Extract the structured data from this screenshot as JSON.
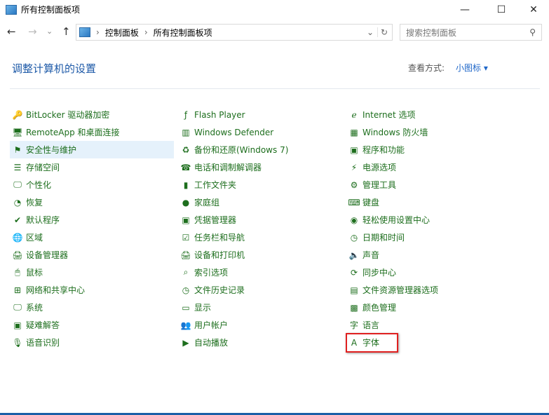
{
  "window": {
    "title": "所有控制面板项",
    "minimize": "—",
    "maximize": "☐",
    "close": "✕"
  },
  "nav": {
    "back": "←",
    "forward": "→",
    "recent": "⌄",
    "up": "↑"
  },
  "address": {
    "crumbs": [
      "控制面板",
      "所有控制面板项"
    ],
    "sep": "›",
    "dropdown": "⌄",
    "refresh": "↻"
  },
  "search": {
    "placeholder": "搜索控制面板",
    "icon": "⚲"
  },
  "heading": "调整计算机的设置",
  "view": {
    "label": "查看方式:",
    "value": "小图标 ▾"
  },
  "columns": [
    [
      {
        "label": "BitLocker 驱动器加密",
        "icon": "🔑"
      },
      {
        "label": "RemoteApp 和桌面连接",
        "icon": "🖥"
      },
      {
        "label": "安全性与维护",
        "icon": "⚑"
      },
      {
        "label": "存储空间",
        "icon": "☰"
      },
      {
        "label": "个性化",
        "icon": "🖵"
      },
      {
        "label": "恢复",
        "icon": "◔"
      },
      {
        "label": "默认程序",
        "icon": "✔"
      },
      {
        "label": "区域",
        "icon": "🌐"
      },
      {
        "label": "设备管理器",
        "icon": "🖨"
      },
      {
        "label": "鼠标",
        "icon": "🖱"
      },
      {
        "label": "网络和共享中心",
        "icon": "⊞"
      },
      {
        "label": "系统",
        "icon": "🖵"
      },
      {
        "label": "疑难解答",
        "icon": "▣"
      },
      {
        "label": "语音识别",
        "icon": "🎙"
      }
    ],
    [
      {
        "label": "Flash Player",
        "icon": "ƒ"
      },
      {
        "label": "Windows Defender",
        "icon": "▥"
      },
      {
        "label": "备份和还原(Windows 7)",
        "icon": "♻"
      },
      {
        "label": "电话和调制解调器",
        "icon": "☎"
      },
      {
        "label": "工作文件夹",
        "icon": "▮"
      },
      {
        "label": "家庭组",
        "icon": "●"
      },
      {
        "label": "凭据管理器",
        "icon": "▣"
      },
      {
        "label": "任务栏和导航",
        "icon": "☑"
      },
      {
        "label": "设备和打印机",
        "icon": "🖨"
      },
      {
        "label": "索引选项",
        "icon": "⌕"
      },
      {
        "label": "文件历史记录",
        "icon": "◷"
      },
      {
        "label": "显示",
        "icon": "▭"
      },
      {
        "label": "用户帐户",
        "icon": "👥"
      },
      {
        "label": "自动播放",
        "icon": "▶"
      }
    ],
    [
      {
        "label": "Internet 选项",
        "icon": "ℯ"
      },
      {
        "label": "Windows 防火墙",
        "icon": "▦"
      },
      {
        "label": "程序和功能",
        "icon": "▣"
      },
      {
        "label": "电源选项",
        "icon": "⚡"
      },
      {
        "label": "管理工具",
        "icon": "⚙"
      },
      {
        "label": "键盘",
        "icon": "⌨"
      },
      {
        "label": "轻松使用设置中心",
        "icon": "◉"
      },
      {
        "label": "日期和时间",
        "icon": "◷"
      },
      {
        "label": "声音",
        "icon": "🔈"
      },
      {
        "label": "同步中心",
        "icon": "⟳"
      },
      {
        "label": "文件资源管理器选项",
        "icon": "▤"
      },
      {
        "label": "颜色管理",
        "icon": "▩"
      },
      {
        "label": "语言",
        "icon": "字"
      },
      {
        "label": "字体",
        "icon": "A"
      }
    ]
  ],
  "colors": {
    "link": "#1d6e1d",
    "accent": "#1e66c8",
    "highlight": "#e5f1fb",
    "annotation": "#e02020"
  }
}
